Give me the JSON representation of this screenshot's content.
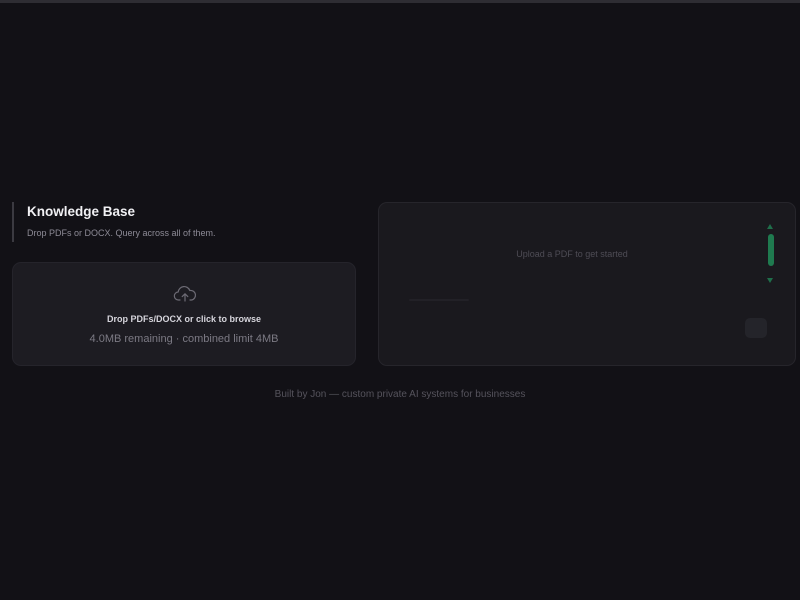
{
  "header": {
    "title": "Knowledge Base",
    "subtitle": "Drop PDFs or DOCX. Query across all of them."
  },
  "dropzone": {
    "icon": "cloud-upload-icon",
    "label": "Drop PDFs/DOCX or click to browse",
    "remaining": "4.0MB remaining · combined limit 4MB"
  },
  "chat_panel": {
    "placeholder": "Upload a PDF to get started",
    "input_placeholder": "",
    "send_icon": "send-icon",
    "accent_color": "#1f7a4f"
  },
  "footer": {
    "text": "Built by Jon — custom private AI systems for businesses"
  }
}
